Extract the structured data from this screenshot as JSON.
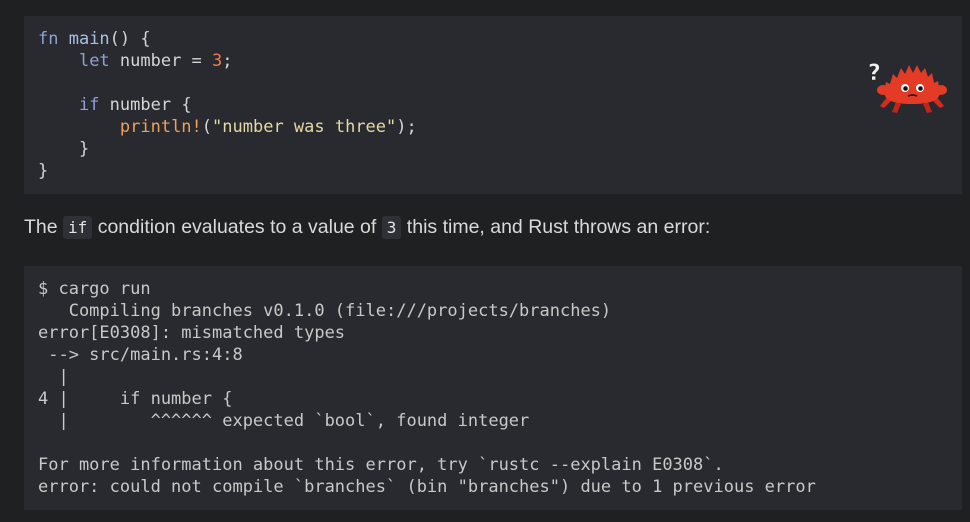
{
  "code_example": {
    "lines": [
      [
        {
          "t": "fn ",
          "c": "kw"
        },
        {
          "t": "main",
          "c": "fn"
        },
        {
          "t": "() {",
          "c": ""
        }
      ],
      [
        {
          "t": "    ",
          "c": ""
        },
        {
          "t": "let ",
          "c": "kw"
        },
        {
          "t": "number = ",
          "c": ""
        },
        {
          "t": "3",
          "c": "num"
        },
        {
          "t": ";",
          "c": ""
        }
      ],
      [],
      [
        {
          "t": "    ",
          "c": ""
        },
        {
          "t": "if ",
          "c": "kw"
        },
        {
          "t": "number {",
          "c": ""
        }
      ],
      [
        {
          "t": "        ",
          "c": ""
        },
        {
          "t": "println!",
          "c": "mac"
        },
        {
          "t": "(",
          "c": ""
        },
        {
          "t": "\"number was three\"",
          "c": "str"
        },
        {
          "t": ");",
          "c": ""
        }
      ],
      [
        {
          "t": "    }",
          "c": ""
        }
      ],
      [
        {
          "t": "}",
          "c": ""
        }
      ]
    ]
  },
  "ferris_icon": "ferris-does-not-compile-icon",
  "ferris_question_mark": "?",
  "prose": {
    "part1": "The ",
    "code1": "if",
    "part2": " condition evaluates to a value of ",
    "code2": "3",
    "part3": " this time, and Rust throws an error:"
  },
  "terminal_output": {
    "lines": [
      "$ cargo run",
      "   Compiling branches v0.1.0 (file:///projects/branches)",
      "error[E0308]: mismatched types",
      " --> src/main.rs:4:8",
      "  |",
      "4 |     if number {",
      "  |        ^^^^^^ expected `bool`, found integer",
      "",
      "For more information about this error, try `rustc --explain E0308`.",
      "error: could not compile `branches` (bin \"branches\") due to 1 previous error"
    ]
  }
}
